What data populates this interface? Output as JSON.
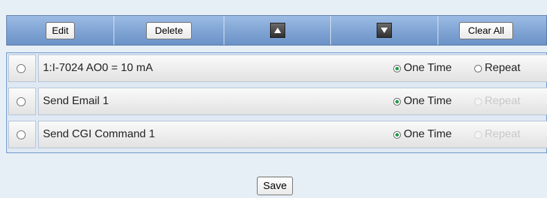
{
  "toolbar": {
    "edit_label": "Edit",
    "delete_label": "Delete",
    "move_up_icon": "triangle-up-icon",
    "move_down_icon": "triangle-down-icon",
    "clear_all_label": "Clear All"
  },
  "schedule_list": {
    "items": [
      {
        "label": "1:I-7024 AO0 = 10 mA",
        "one_time_label": "One Time",
        "repeat_label": "Repeat",
        "one_time_selected": true,
        "repeat_enabled": true
      },
      {
        "label": "Send Email 1",
        "one_time_label": "One Time",
        "repeat_label": "Repeat",
        "one_time_selected": true,
        "repeat_enabled": false
      },
      {
        "label": "Send CGI Command 1",
        "one_time_label": "One Time",
        "repeat_label": "Repeat",
        "one_time_selected": true,
        "repeat_enabled": false
      }
    ]
  },
  "footer": {
    "save_label": "Save"
  },
  "colors": {
    "toolbar_bg": "#7fa3d3",
    "panel_bg": "#e6eef6",
    "checked_radio": "#1f9a45"
  }
}
